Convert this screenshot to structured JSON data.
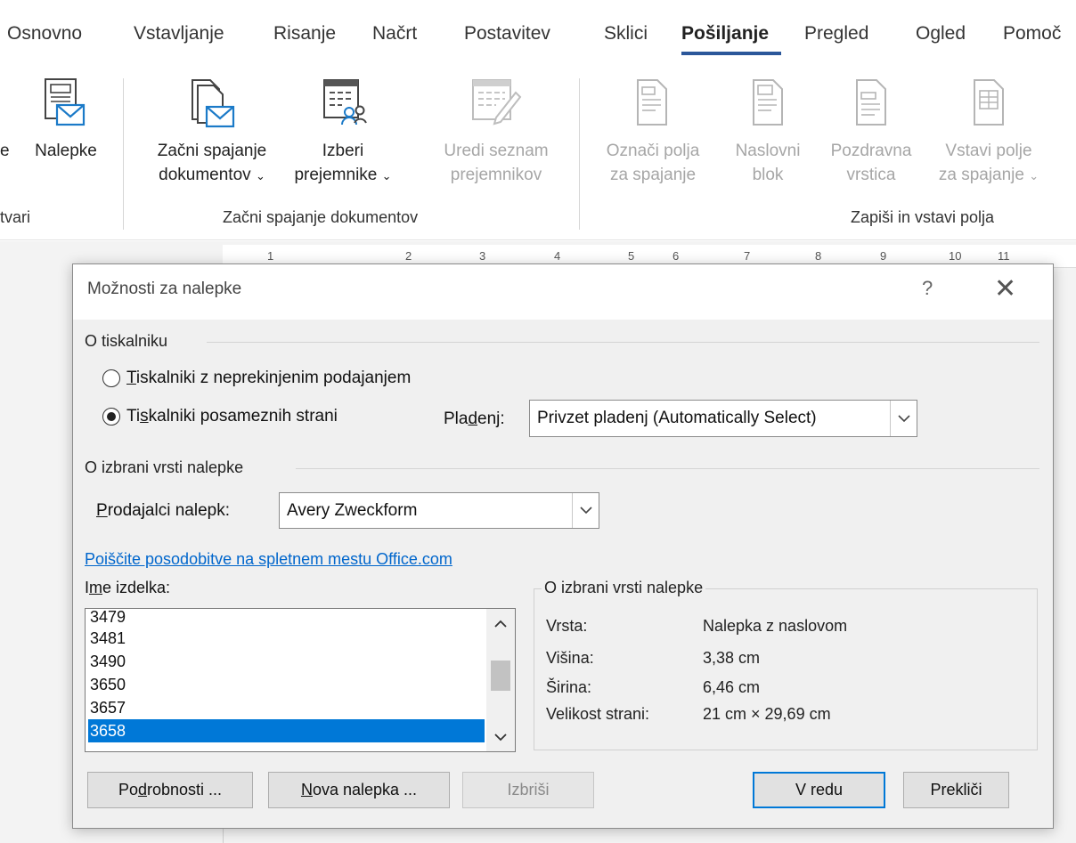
{
  "tabs": [
    {
      "label": "Osnovno"
    },
    {
      "label": "Vstavljanje"
    },
    {
      "label": "Risanje"
    },
    {
      "label": "Načrt"
    },
    {
      "label": "Postavitev"
    },
    {
      "label": "Sklici"
    },
    {
      "label": "Pošiljanje"
    },
    {
      "label": "Pregled"
    },
    {
      "label": "Ogled"
    },
    {
      "label": "Pomoč"
    }
  ],
  "ribbon": {
    "left_partial_label": "e",
    "nalepke": "Nalepke",
    "left_group_label": "tvari",
    "start_merge": {
      "line1": "Začni spajanje",
      "line2": "dokumentov"
    },
    "select_recipients": {
      "line1": "Izberi",
      "line2": "prejemnike"
    },
    "edit_recipients": {
      "line1": "Uredi seznam",
      "line2": "prejemnikov"
    },
    "group_start_merge": "Začni spajanje dokumentov",
    "highlight_fields": {
      "line1": "Označi polja",
      "line2": "za spajanje"
    },
    "address_block": {
      "line1": "Naslovni",
      "line2": "blok"
    },
    "greeting_line": {
      "line1": "Pozdravna",
      "line2": "vrstica"
    },
    "insert_field": {
      "line1": "Vstavi polje",
      "line2": "za spajanje"
    },
    "group_write_insert": "Zapiši in vstavi polja"
  },
  "ruler": [
    "1",
    "2",
    "3",
    "4",
    "5",
    "6",
    "7",
    "8",
    "9",
    "10",
    "11"
  ],
  "dialog": {
    "title": "Možnosti za nalepke",
    "help": "?",
    "close": "✕",
    "printer_section": "O tiskalniku",
    "continuous": {
      "key": "T",
      "rest": "iskalniki z neprekinjenim podajanjem"
    },
    "page_printers": {
      "pre": "Ti",
      "key": "s",
      "rest": "kalniki posameznih strani"
    },
    "tray_label": {
      "pre": "Pla",
      "key": "d",
      "rest": "enj:"
    },
    "tray_value": "Privzet pladenj (Automatically Select)",
    "label_section": "O izbrani vrsti nalepke",
    "vendor_label": {
      "key": "P",
      "rest": "rodajalci nalepk:"
    },
    "vendor_value": "Avery Zweckform",
    "update_link": "Poiščite posodobitve na spletnem mestu Office.com",
    "product_label": {
      "pre": "I",
      "key": "m",
      "rest": "e izdelka:"
    },
    "products": [
      "3479",
      "3481",
      "3490",
      "3650",
      "3657",
      "3658"
    ],
    "selected_product": "3658",
    "info_title": "O izbrani vrsti nalepke",
    "info": [
      {
        "key": "Vrsta:",
        "value": "Nalepka z naslovom"
      },
      {
        "key": "Višina:",
        "value": "3,38 cm"
      },
      {
        "key": "Širina:",
        "value": "6,46 cm"
      },
      {
        "key": "Velikost strani:",
        "value": "21 cm × 29,69 cm"
      }
    ],
    "buttons": {
      "details": {
        "pre": "Po",
        "key": "d",
        "rest": "robnosti ..."
      },
      "new_label": {
        "key": "N",
        "rest": "ova nalepka ..."
      },
      "delete": "Izbriši",
      "ok": "V redu",
      "cancel": "Prekliči"
    }
  },
  "colors": {
    "accent": "#0078d7",
    "tab_underline": "#2b579a",
    "link": "#0066cc"
  }
}
